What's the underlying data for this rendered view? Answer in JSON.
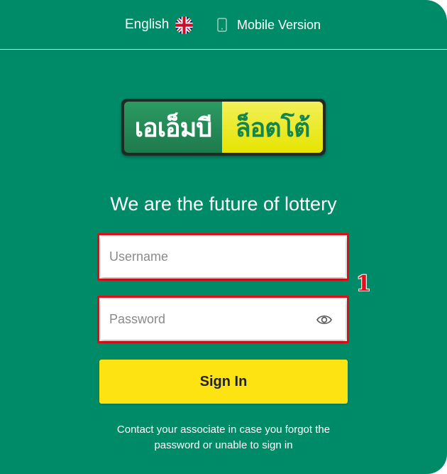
{
  "header": {
    "language_label": "English",
    "language_flag": "uk-flag-icon",
    "mobile_label": "Mobile Version",
    "mobile_icon": "phone-icon"
  },
  "logo": {
    "left_text": "เอเอ็มบี",
    "right_text": "ล็อตโต้"
  },
  "tagline": "We are the future of lottery",
  "form": {
    "username_placeholder": "Username",
    "password_placeholder": "Password",
    "password_toggle_icon": "eye-icon",
    "signin_label": "Sign In"
  },
  "annotation_marker": "1",
  "help_text": "Contact your associate in case you forgot the password or unable to sign in",
  "colors": {
    "background": "#008b68",
    "accent_yellow": "#fde311",
    "highlight_red": "#e0101a"
  }
}
